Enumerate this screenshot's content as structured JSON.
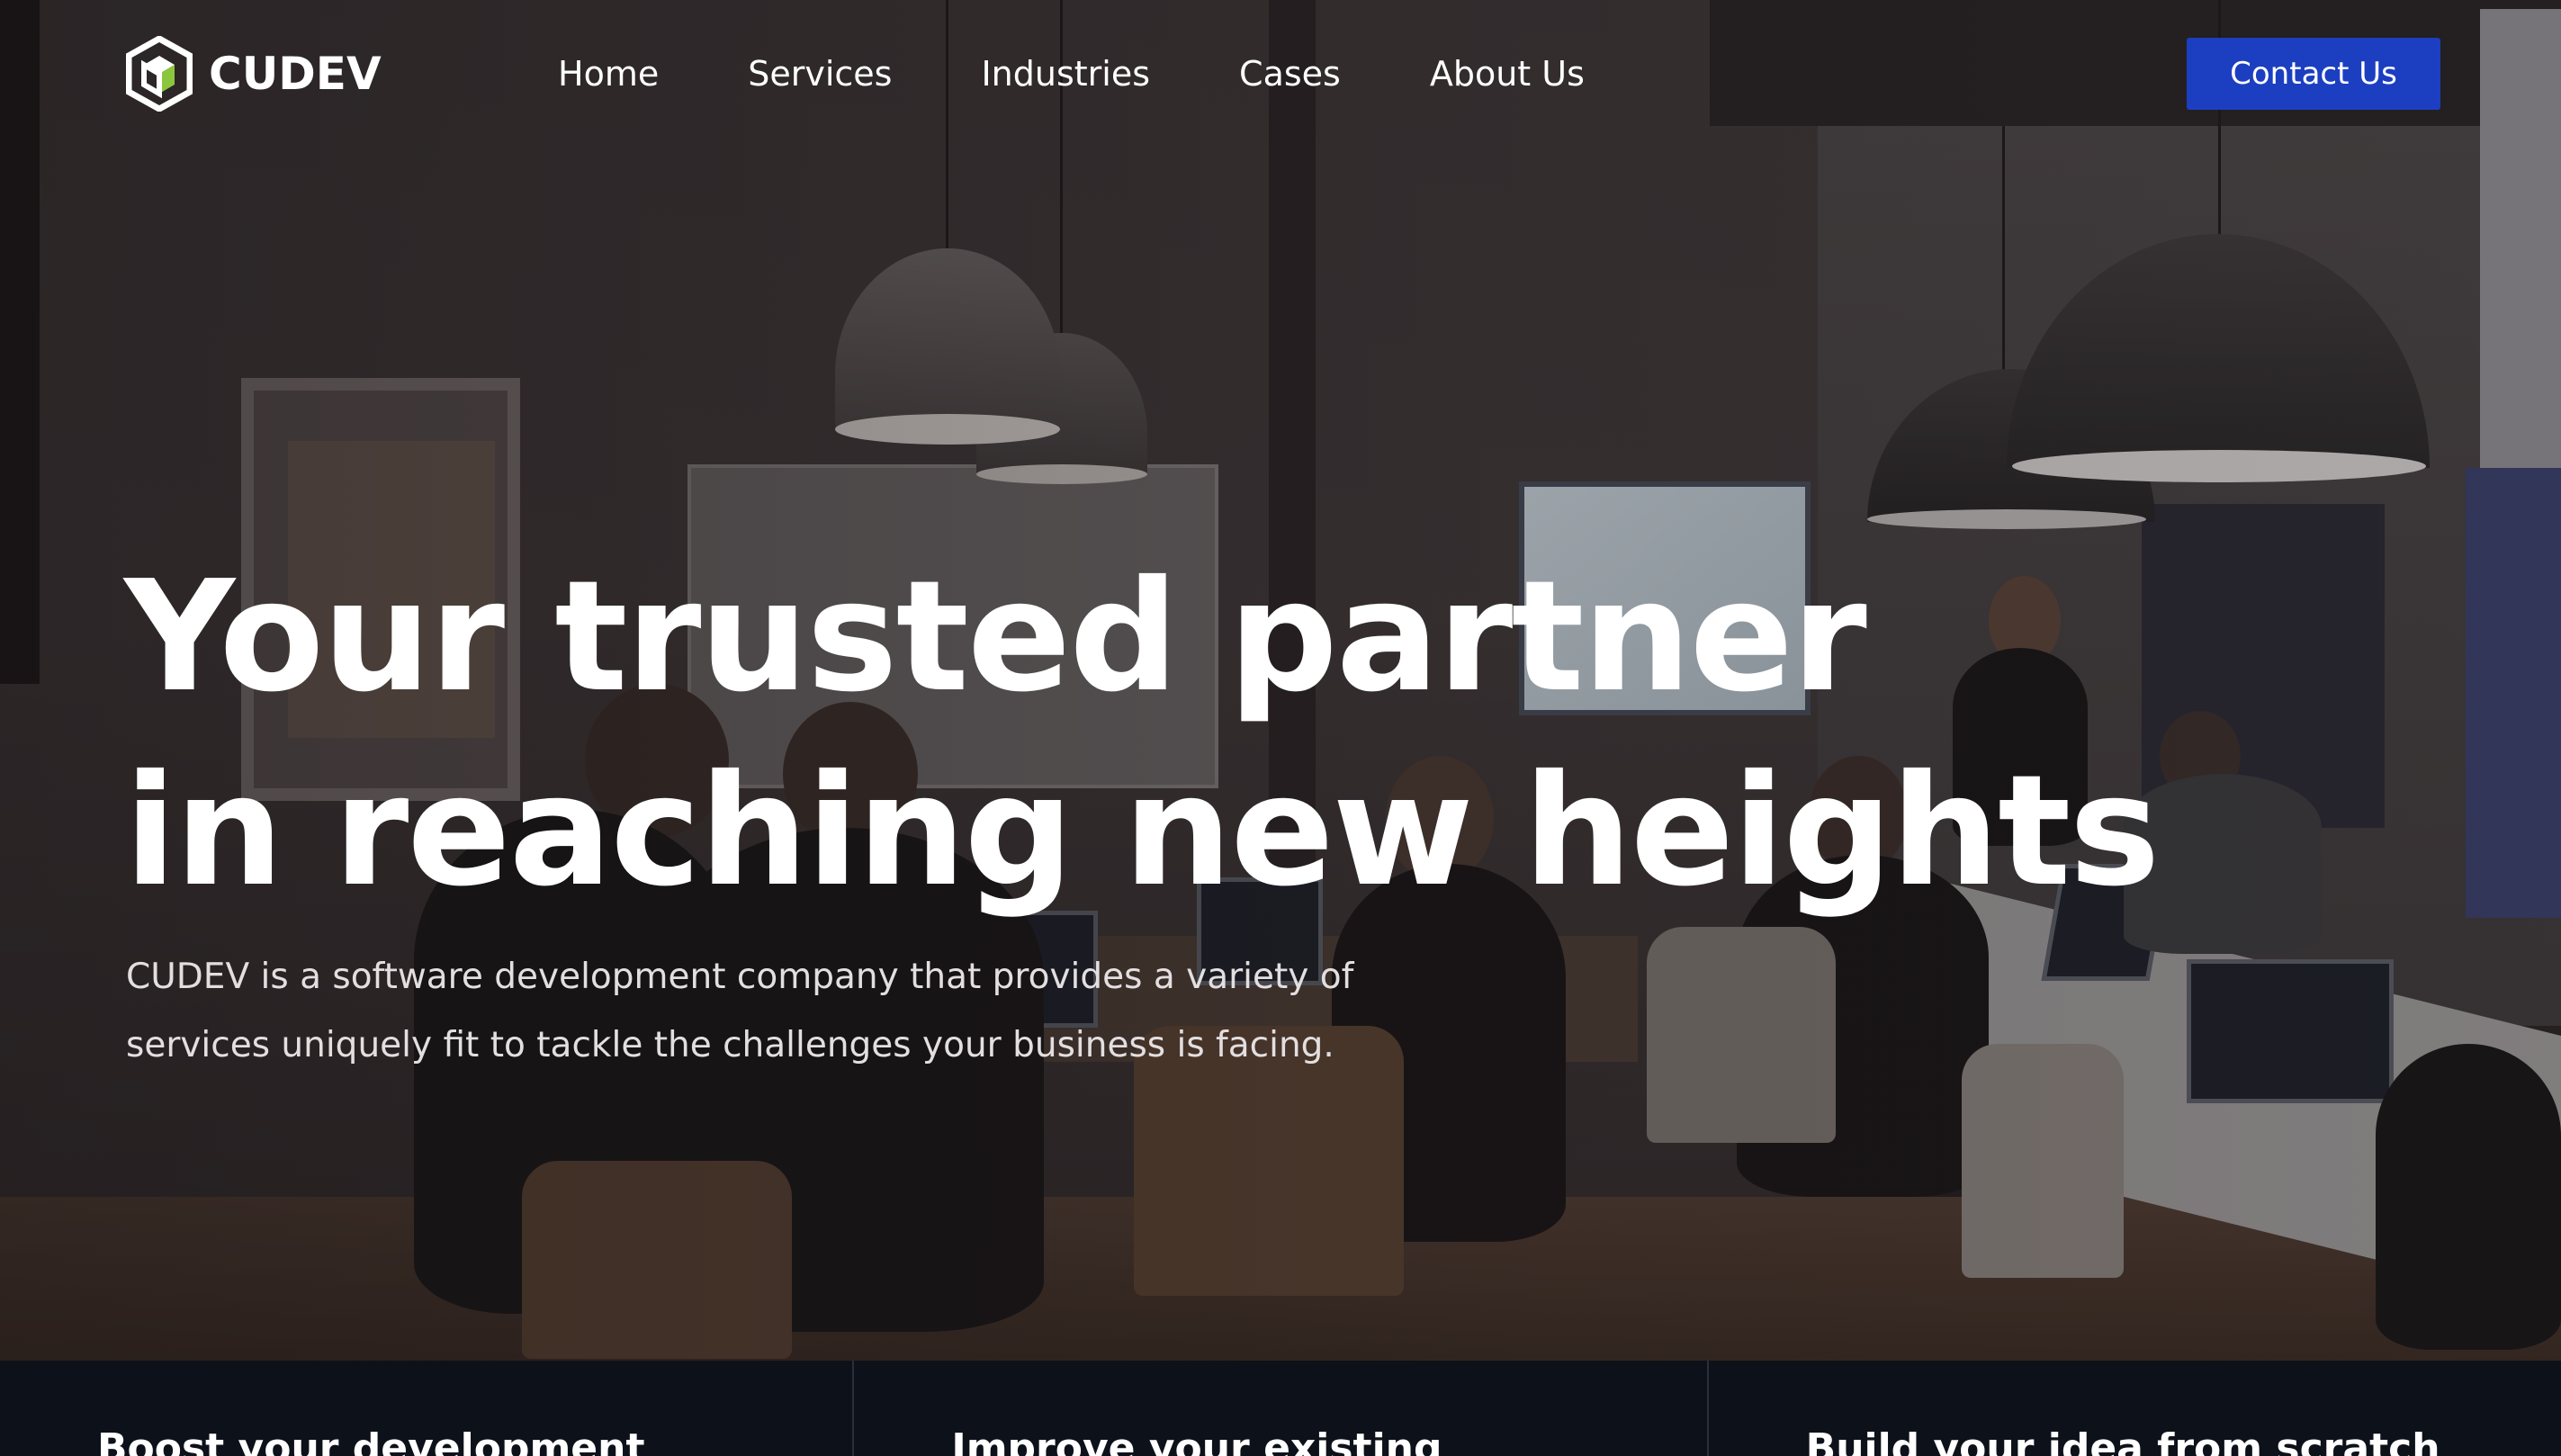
{
  "brand": {
    "name": "CUDEV",
    "accent": "#8cc63f",
    "primary": "#1c3fc1"
  },
  "nav": {
    "items": [
      {
        "label": "Home"
      },
      {
        "label": "Services"
      },
      {
        "label": "Industries"
      },
      {
        "label": "Cases"
      },
      {
        "label": "About Us"
      }
    ],
    "cta_label": "Contact Us"
  },
  "hero": {
    "headline_line1": "Your trusted partner",
    "headline_line2": "in reaching new heights",
    "description": "CUDEV is a software development company that provides a variety of services uniquely fit to tackle the challenges your business is facing."
  },
  "cards": [
    {
      "title": "Boost your development"
    },
    {
      "title": "Improve your existing"
    },
    {
      "title": "Build your idea from scratch"
    }
  ]
}
